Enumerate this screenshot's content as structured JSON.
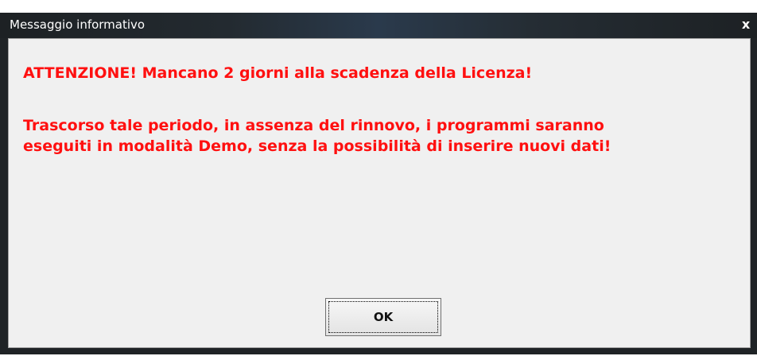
{
  "window": {
    "title": "Messaggio informativo",
    "close_glyph": "x"
  },
  "message": {
    "line1": "ATTENZIONE! Mancano 2 giorni alla scadenza della Licenza!",
    "line2": "Trascorso tale periodo, in assenza del rinnovo, i programmi saranno",
    "line3": "eseguiti in modalità Demo, senza la possibilità di inserire nuovi dati!",
    "color": "#ff1010"
  },
  "buttons": {
    "ok_label": "OK"
  },
  "icons": {
    "close": "close-icon"
  }
}
